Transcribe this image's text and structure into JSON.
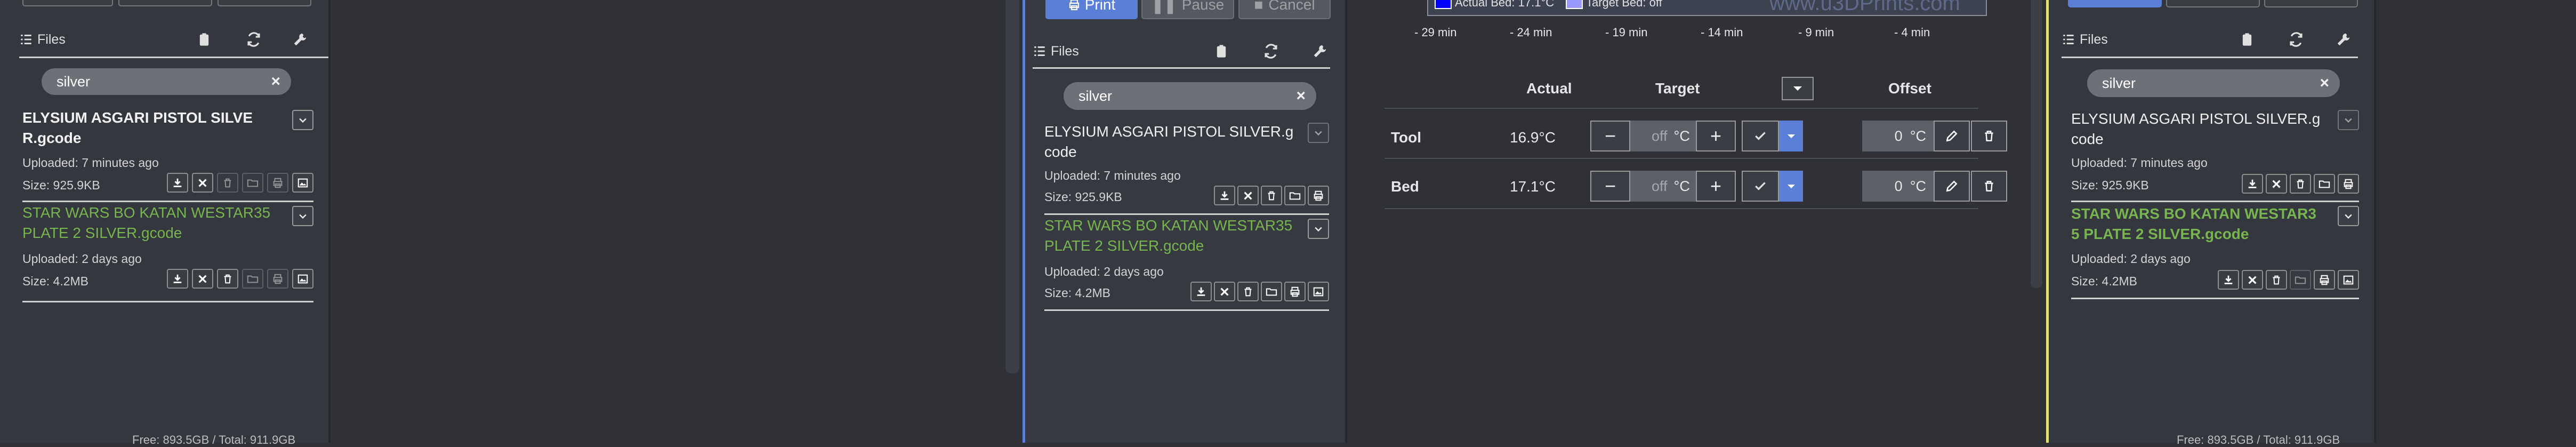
{
  "panel_a": {
    "files_title": "Files",
    "search_value": "silver",
    "file1": {
      "name_line1": "ELYSIUM ASGARI PISTOL SILVE",
      "name_line2": "R.gcode",
      "uploaded": "Uploaded: 7 minutes ago",
      "size": "Size: 925.9KB"
    },
    "file2": {
      "name_line1": "STAR WARS BO KATAN WESTAR35",
      "name_line2": "PLATE 2 SILVER.gcode",
      "uploaded": "Uploaded: 2 days ago",
      "size": "Size: 4.2MB"
    },
    "footer": "Free: 893.5GB / Total: 911.9GB"
  },
  "panel_b": {
    "print_label": "Print",
    "pause_label": "Pause",
    "cancel_label": "Cancel",
    "files_title": "Files",
    "search_value": "silver",
    "file1": {
      "name_line1": "ELYSIUM ASGARI PISTOL SILVER.g",
      "name_line2": "code",
      "uploaded": "Uploaded: 7 minutes ago",
      "size": "Size: 925.9KB"
    },
    "file2": {
      "name_line1": "STAR WARS BO KATAN WESTAR35",
      "name_line2": "PLATE 2 SILVER.gcode",
      "uploaded": "Uploaded: 2 days ago",
      "size": "Size: 4.2MB"
    }
  },
  "temperature": {
    "legend": {
      "actual_bed": "Actual Bed: 17.1°C",
      "target_bed": "Target Bed: off",
      "watermark": "www.u3DPrints.com"
    },
    "time_labels": [
      "- 29 min",
      "- 24 min",
      "- 19 min",
      "- 14 min",
      "- 9 min",
      "- 4 min"
    ],
    "headers": {
      "actual": "Actual",
      "target": "Target",
      "offset": "Offset"
    },
    "rows": [
      {
        "label": "Tool",
        "actual": "16.9°C",
        "target": "off",
        "target_unit": "°C",
        "offset": "0",
        "offset_unit": "°C"
      },
      {
        "label": "Bed",
        "actual": "17.1°C",
        "target": "off",
        "target_unit": "°C",
        "offset": "0",
        "offset_unit": "°C"
      }
    ],
    "colors": {
      "actual_bed": "#0000ff",
      "target_bed": "#9999ff"
    }
  },
  "panel_c": {
    "files_title": "Files",
    "search_value": "silver",
    "file1": {
      "name_line1": "ELYSIUM ASGARI PISTOL SILVER.g",
      "name_line2": "code",
      "uploaded": "Uploaded: 7 minutes ago",
      "size": "Size: 925.9KB"
    },
    "file2": {
      "name_line1": "STAR WARS BO KATAN WESTAR3",
      "name_line2": "5 PLATE 2 SILVER.gcode",
      "uploaded": "Uploaded: 2 days ago",
      "size": "Size: 4.2MB"
    },
    "footer": "Free: 893.5GB / Total: 911.9GB"
  },
  "theme": {
    "accent": "#5b7fd6",
    "highlight": "#e3e07a",
    "green": "#78b44f"
  }
}
